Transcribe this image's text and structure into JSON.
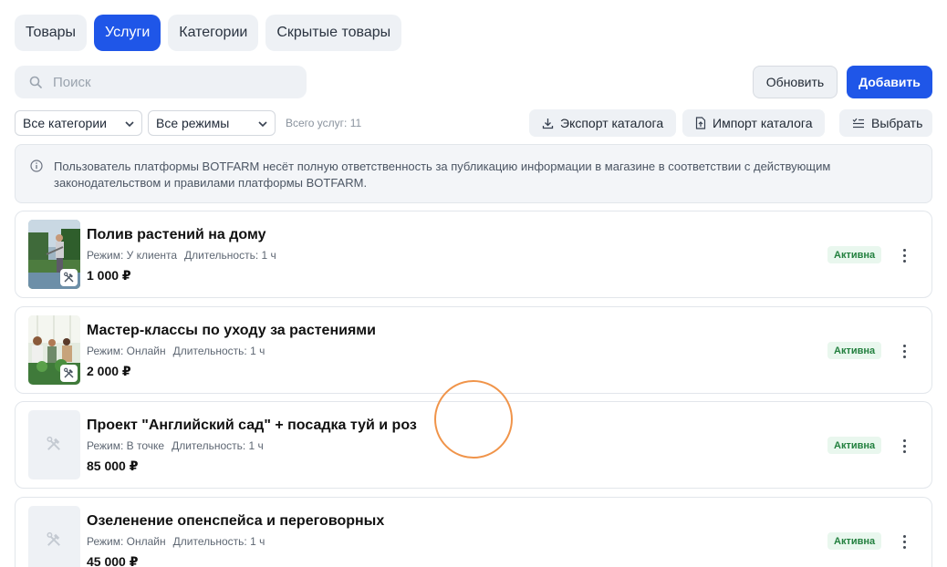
{
  "tabs": [
    {
      "label": "Товары",
      "active": false
    },
    {
      "label": "Услуги",
      "active": true
    },
    {
      "label": "Категории",
      "active": false
    },
    {
      "label": "Скрытые товары",
      "active": false
    }
  ],
  "search": {
    "placeholder": "Поиск",
    "value": ""
  },
  "toolbar": {
    "refresh_label": "Обновить",
    "add_label": "Добавить"
  },
  "filters": {
    "category_selected": "Все категории",
    "mode_selected": "Все режимы",
    "total_text": "Всего услуг: 11"
  },
  "actions": {
    "export_label": "Экспорт каталога",
    "import_label": "Импорт каталога",
    "select_label": "Выбрать"
  },
  "notice": {
    "text": "Пользователь платформы BOTFARM несёт полную ответственность за публикацию информации в магазине в соответствии с действующим законодательством и правилами платформы BOTFARM."
  },
  "services": [
    {
      "title": "Полив растений на дому",
      "mode": "Режим: У клиента",
      "duration": "Длительность: 1 ч",
      "price": "1 000 ₽",
      "status": "Активна",
      "image": "photo-garden-watering"
    },
    {
      "title": "Мастер-классы по уходу за растениями",
      "mode": "Режим: Онлайн",
      "duration": "Длительность: 1 ч",
      "price": "2 000 ₽",
      "status": "Активна",
      "image": "photo-plant-class"
    },
    {
      "title": "Проект \"Английский сад\" + посадка туй и роз",
      "mode": "Режим: В точке",
      "duration": "Длительность: 1 ч",
      "price": "85 000 ₽",
      "status": "Активна",
      "image": "placeholder-tools-icon"
    },
    {
      "title": "Озеленение опенспейса и переговорных",
      "mode": "Режим: Онлайн",
      "duration": "Длительность: 1 ч",
      "price": "45 000 ₽",
      "status": "Активна",
      "image": "placeholder-tools-icon"
    }
  ],
  "colors": {
    "accent": "#1f56e8",
    "status_bg": "#e9f7ee",
    "status_text": "#23803f",
    "cursor_ring": "#f0944a"
  }
}
